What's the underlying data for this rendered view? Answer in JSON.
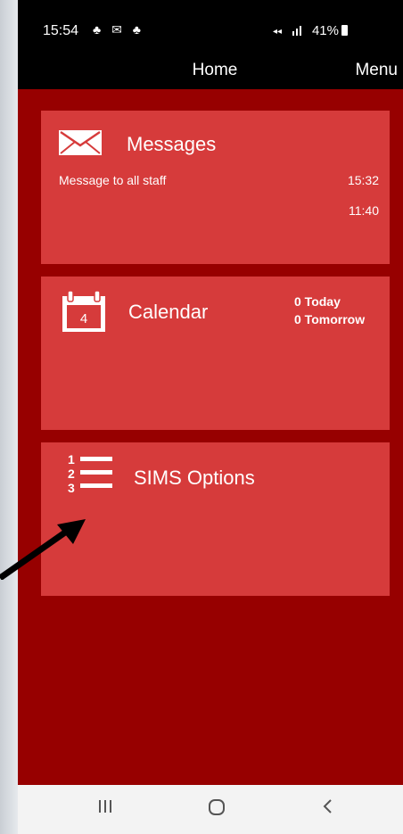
{
  "status": {
    "time": "15:54",
    "left_icons": "♣ ✉ ♣",
    "right_text": "41%"
  },
  "nav": {
    "title": "Home",
    "menu": "Menu"
  },
  "messages": {
    "title": "Messages",
    "items": [
      {
        "text": "Message to all staff",
        "time": "15:32"
      },
      {
        "text": "",
        "time": "11:40"
      }
    ]
  },
  "calendar": {
    "title": "Calendar",
    "day": "4",
    "today": "0 Today",
    "tomorrow": "0 Tomorrow"
  },
  "sims": {
    "title": "SIMS Options",
    "numbers": [
      "1",
      "2",
      "3"
    ]
  },
  "colors": {
    "background": "#970000",
    "tile": "#d63b3b",
    "bar": "#000000"
  }
}
